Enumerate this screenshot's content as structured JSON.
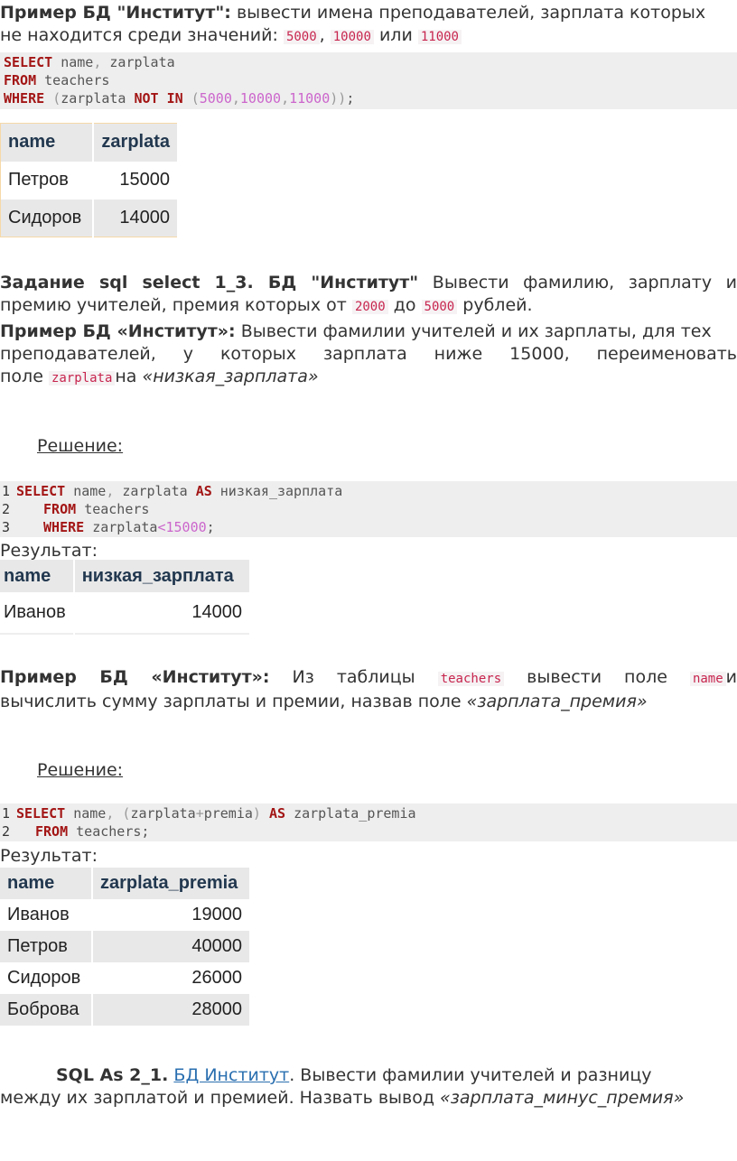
{
  "ex1": {
    "bold": "Пример БД \"Институт\":",
    "text1": "вывести имена преподавателей, зарплата которых",
    "text2": "не находится среди значений:",
    "v1": "5000",
    "sep": ",",
    "v2": "10000",
    "or": "или",
    "v3": "11000",
    "code": {
      "l1_kw": "SELECT",
      "l1_rest": "name",
      "l1_comma": ",",
      "l1_rest2": "zarplata",
      "l2_kw": "FROM",
      "l2_rest": "teachers",
      "l3_kw": "WHERE",
      "l3_p1": "(",
      "l3_col": "zarplata",
      "l3_not": "NOT",
      "l3_in": "IN",
      "l3_p2": "(",
      "l3_n1": "5000",
      "l3_c1": ",",
      "l3_n2": "10000",
      "l3_c2": ",",
      "l3_n3": "11000",
      "l3_p3": "))",
      "l3_semi": ";"
    },
    "table": {
      "headers": [
        "name",
        "zarplata"
      ],
      "rows": [
        [
          "Петров",
          "15000"
        ],
        [
          "Сидоров",
          "14000"
        ]
      ]
    }
  },
  "task": {
    "bold": "Задание sql select 1_3. БД \"Институт\"",
    "text1": "Вывести фамилию, зарплату и",
    "text2": "премию учителей, премия которых от",
    "v1": "2000",
    "mid": "до",
    "v2": "5000",
    "end": "рублей."
  },
  "ex2": {
    "bold": "Пример БД «Институт»:",
    "text1": "Вывести фамилии учителей и их зарплаты, для тех",
    "text2": "преподавателей, у которых зарплата ниже 15000, переименовать",
    "text3a": "поле",
    "field": "zarplata",
    "text3b": "на",
    "alias": "«низкая_зарплата»",
    "solution": "Решение:",
    "code": {
      "n1": "1",
      "l1_kw": "SELECT",
      "l1_a": "name",
      "l1_c": ",",
      "l1_b": "zarplata",
      "l1_as": "AS",
      "l1_alias": "низкая_зарплата",
      "n2": "2",
      "l2_kw": "FROM",
      "l2_rest": "teachers",
      "n3": "3",
      "l3_kw": "WHERE",
      "l3_col": "zarplata",
      "l3_op": "<",
      "l3_num": "15000",
      "l3_semi": ";"
    },
    "result": "Результат:",
    "table": {
      "headers": [
        "name",
        "низкая_зарплата"
      ],
      "rows": [
        [
          "Иванов",
          "14000"
        ]
      ]
    }
  },
  "ex3": {
    "bold": "Пример БД «Институт»:",
    "text1a": "Из таблицы",
    "tbl": "teachers",
    "text1b": "вывести поле",
    "field": "name",
    "text1c": "и",
    "text2": "вычислить сумму зарплаты и премии, назвав поле",
    "alias": "«зарплата_премия»",
    "solution": "Решение:",
    "code": {
      "n1": "1",
      "l1_kw": "SELECT",
      "l1_a": "name",
      "l1_c": ",",
      "l1_p1": "(",
      "l1_b": "zarplata",
      "l1_plus": "+",
      "l1_c2": "premia",
      "l1_p2": ")",
      "l1_as": "AS",
      "l1_alias": "zarplata_premia",
      "n2": "2",
      "l2_kw": "FROM",
      "l2_rest": "teachers;"
    },
    "result": "Результат:",
    "table": {
      "headers": [
        "name",
        "zarplata_premia"
      ],
      "rows": [
        [
          "Иванов",
          "19000"
        ],
        [
          "Петров",
          "40000"
        ],
        [
          "Сидоров",
          "26000"
        ],
        [
          "Боброва",
          "28000"
        ]
      ]
    }
  },
  "task2": {
    "bold": "SQL As 2_1.",
    "link": "БД Институт",
    "text1": ". Вывести фамилии учителей и разницу",
    "text2": "между их зарплатой и премией. Назвать вывод",
    "alias": "«зарплата_минус_премия»"
  }
}
